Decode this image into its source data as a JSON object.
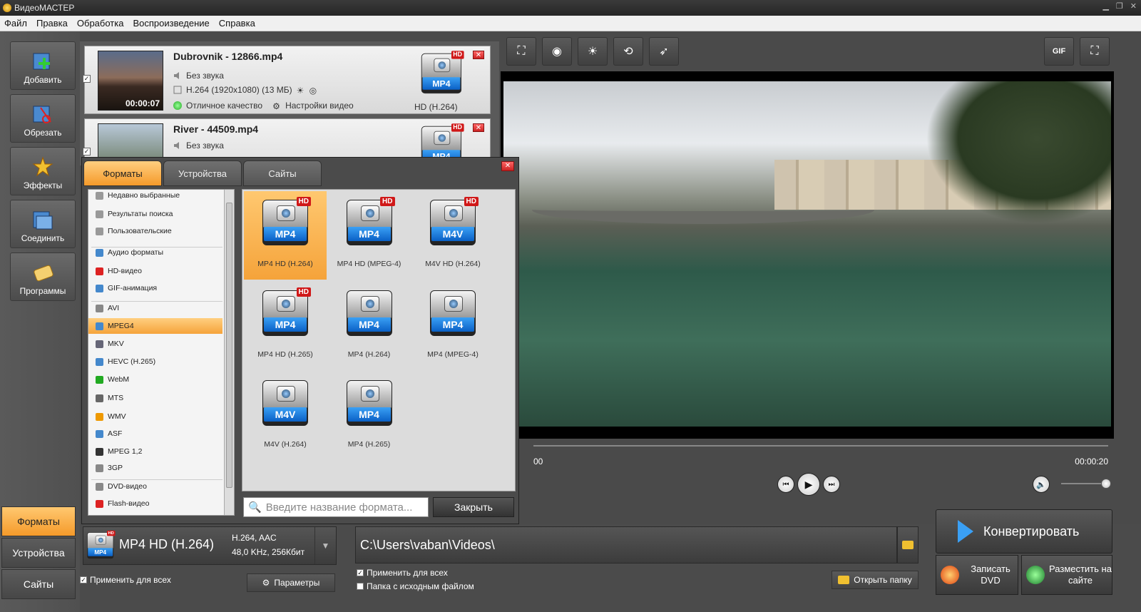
{
  "app": {
    "title": "ВидеоМАСТЕР"
  },
  "menu": [
    "Файл",
    "Правка",
    "Обработка",
    "Воспроизведение",
    "Справка"
  ],
  "sidebar": {
    "buttons": [
      {
        "label": "Добавить",
        "icon": "add-video-icon"
      },
      {
        "label": "Обрезать",
        "icon": "scissors-icon"
      },
      {
        "label": "Эффекты",
        "icon": "effects-wand-icon"
      },
      {
        "label": "Соединить",
        "icon": "join-icon"
      },
      {
        "label": "Программы",
        "icon": "programs-icon"
      }
    ],
    "tabs": [
      "Форматы",
      "Устройства",
      "Сайты"
    ],
    "active_tab": "Форматы"
  },
  "files": [
    {
      "name": "Dubrovnik - 12866.mp4",
      "duration": "00:00:07",
      "audio": "Без звука",
      "codec": "H.264 (1920x1080) (13 МБ)",
      "quality": "Отличное качество",
      "settings": "Настройки видео",
      "format_band": "MP4",
      "format_hd": "HD",
      "format_label": "HD (H.264)",
      "checked": true
    },
    {
      "name": "River - 44509.mp4",
      "audio": "Без звука",
      "format_band": "MP4",
      "format_hd": "HD",
      "checked": true
    }
  ],
  "format_dialog": {
    "tabs": [
      "Форматы",
      "Устройства",
      "Сайты"
    ],
    "categories": [
      "Недавно выбранные",
      "Результаты поиска",
      "Пользовательские",
      "Аудио форматы",
      "HD-видео",
      "GIF-анимация",
      "AVI",
      "MPEG4",
      "MKV",
      "HEVC (H.265)",
      "WebM",
      "MTS",
      "WMV",
      "ASF",
      "MPEG 1,2",
      "3GP",
      "DVD-видео",
      "Flash-видео"
    ],
    "active_category": "MPEG4",
    "formats": [
      {
        "band": "MP4",
        "hd": "HD",
        "label": "MP4 HD (H.264)",
        "selected": true
      },
      {
        "band": "MP4",
        "hd": "HD",
        "label": "MP4 HD (MPEG-4)"
      },
      {
        "band": "M4V",
        "hd": "HD",
        "label": "M4V HD (H.264)"
      },
      {
        "band": "MP4",
        "hd": "HD",
        "label": "MP4 HD (H.265)"
      },
      {
        "band": "MP4",
        "hd": "",
        "label": "MP4 (H.264)"
      },
      {
        "band": "MP4",
        "hd": "",
        "label": "MP4 (MPEG-4)"
      },
      {
        "band": "M4V",
        "hd": "",
        "label": "M4V (H.264)"
      },
      {
        "band": "MP4",
        "hd": "",
        "label": "MP4 (H.265)"
      }
    ],
    "search_placeholder": "Введите название формата...",
    "close_label": "Закрыть"
  },
  "toolbar": {
    "left_buttons": [
      "crop-icon",
      "stabilize-icon",
      "brightness-icon",
      "rotate-icon",
      "speed-icon"
    ],
    "gif_label": "GIF",
    "right_icon": "fullscreen-icon"
  },
  "player": {
    "time_start": "00",
    "time_end": "00:00:20"
  },
  "bottom": {
    "selected_format": {
      "band": "MP4",
      "hd": "HD",
      "name": "MP4 HD (H.264)",
      "codec": "H.264, AAC",
      "audio": "48,0 KHz, 256Кбит"
    },
    "apply_all_left": "Применить для всех",
    "params_label": "Параметры",
    "output_path": "C:\\Users\\vaban\\Videos\\",
    "apply_all_right": "Применить для всех",
    "source_folder": "Папка с исходным файлом",
    "open_folder": "Открыть папку",
    "convert_label": "Конвертировать",
    "dvd_label": "Записать DVD",
    "web_label": "Разместить на сайте"
  },
  "colors": {
    "accent_orange": "#f59a2a",
    "format_blue": "#0a60c5",
    "hd_red": "#d01818"
  }
}
